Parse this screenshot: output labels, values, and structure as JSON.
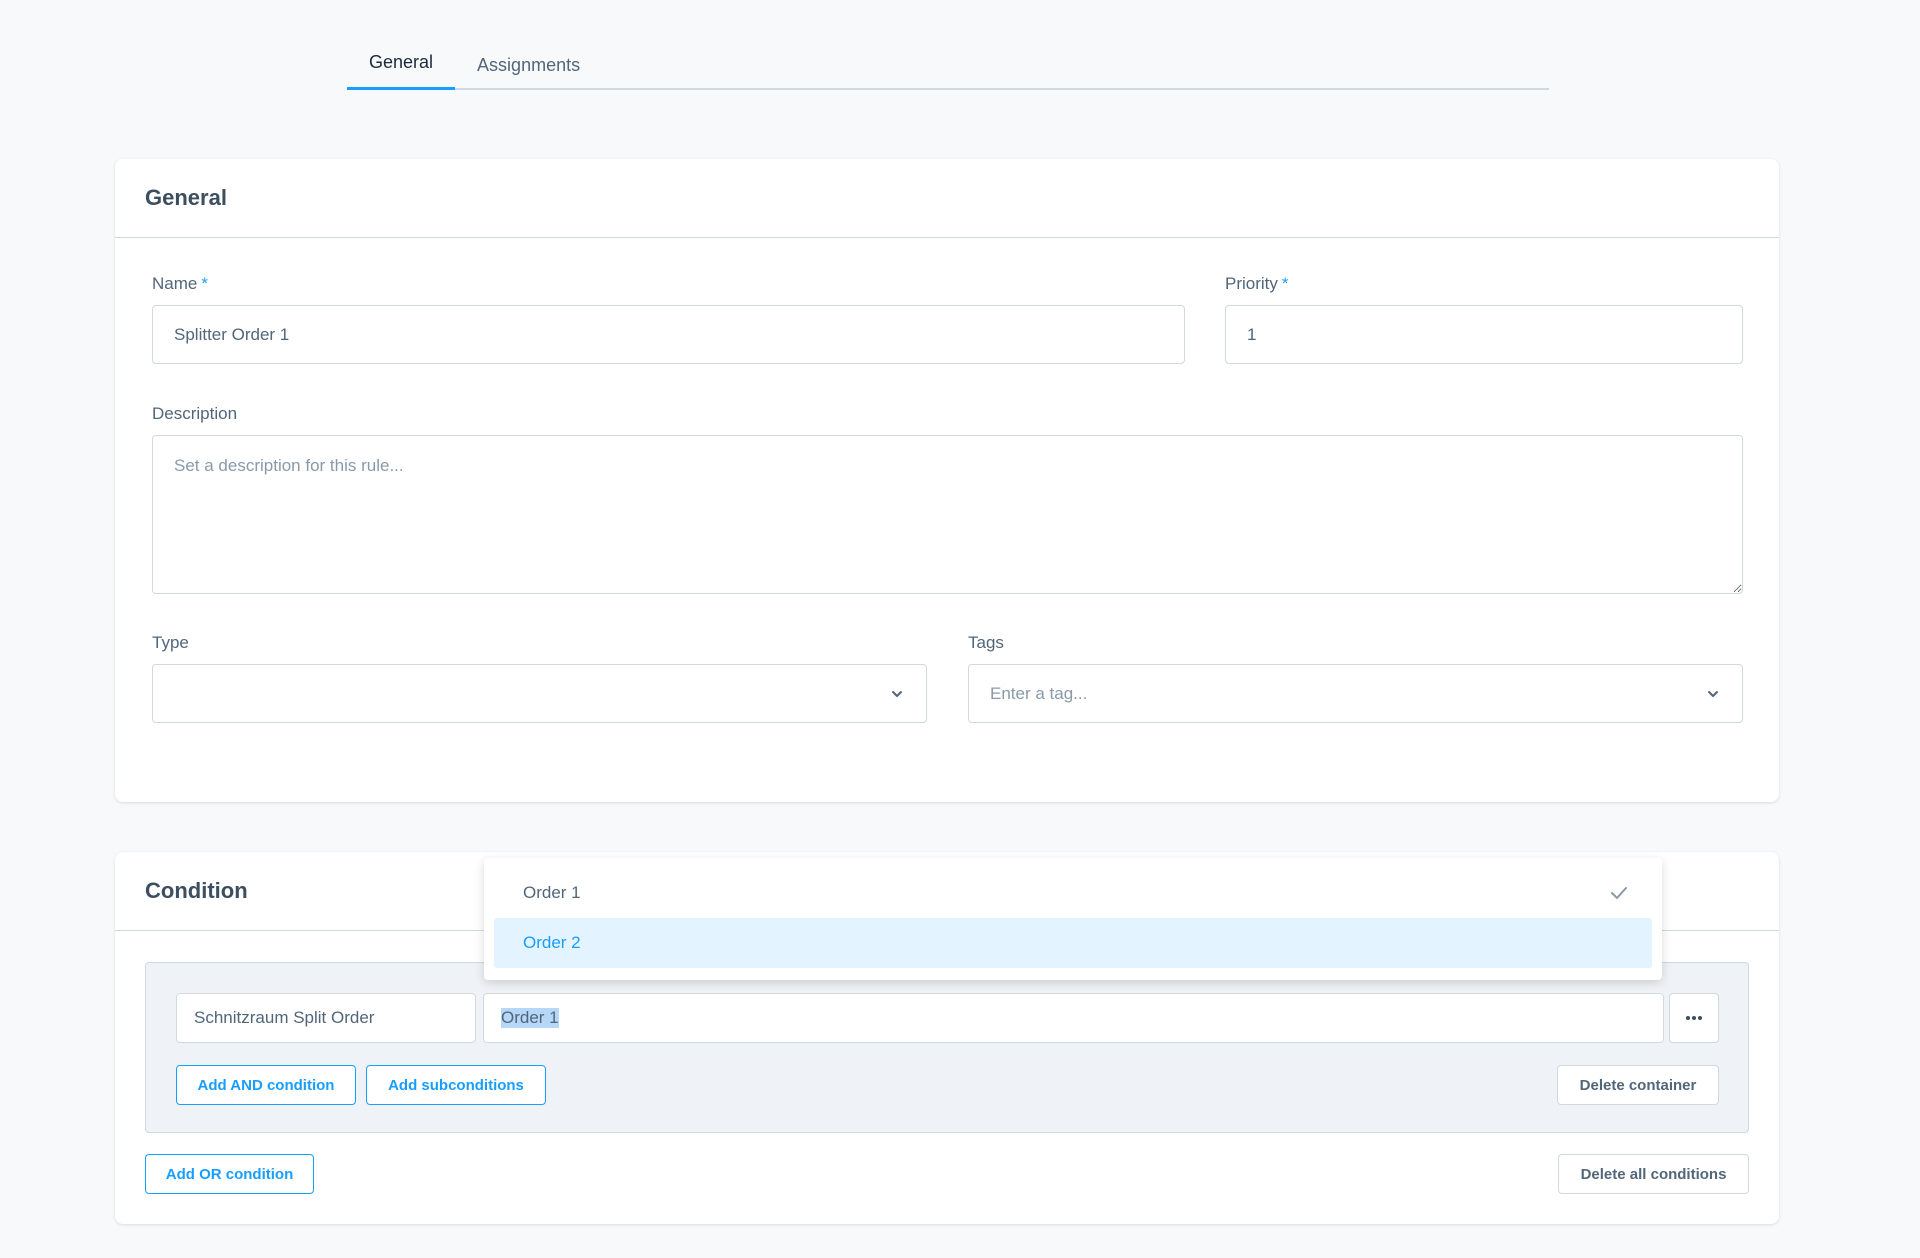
{
  "tabs": [
    {
      "label": "General",
      "active": true
    },
    {
      "label": "Assignments",
      "active": false
    }
  ],
  "general_card": {
    "title": "General",
    "name": {
      "label": "Name",
      "required_mark": "*",
      "value": "Splitter Order 1"
    },
    "priority": {
      "label": "Priority",
      "required_mark": "*",
      "value": "1"
    },
    "description": {
      "label": "Description",
      "placeholder": "Set a description for this rule..."
    },
    "type": {
      "label": "Type",
      "value": ""
    },
    "tags": {
      "label": "Tags",
      "placeholder": "Enter a tag..."
    }
  },
  "condition_card": {
    "title": "Condition",
    "field_value": "Schnitzraum Split Order",
    "operand_value": "Order 1",
    "more_icon": "ellipsis-icon",
    "add_and_label": "Add AND condition",
    "add_sub_label": "Add subconditions",
    "delete_container_label": "Delete container",
    "add_or_label": "Add OR condition",
    "delete_all_label": "Delete all conditions"
  },
  "dropdown": {
    "options": [
      {
        "label": "Order 1",
        "selected": true
      },
      {
        "label": "Order 2",
        "highlighted": true
      }
    ]
  },
  "colors": {
    "accent": "#189eff",
    "background": "#f8f9fb",
    "border": "#d1d9e0",
    "container": "#eff2f6",
    "highlight": "#e3f3ff"
  }
}
